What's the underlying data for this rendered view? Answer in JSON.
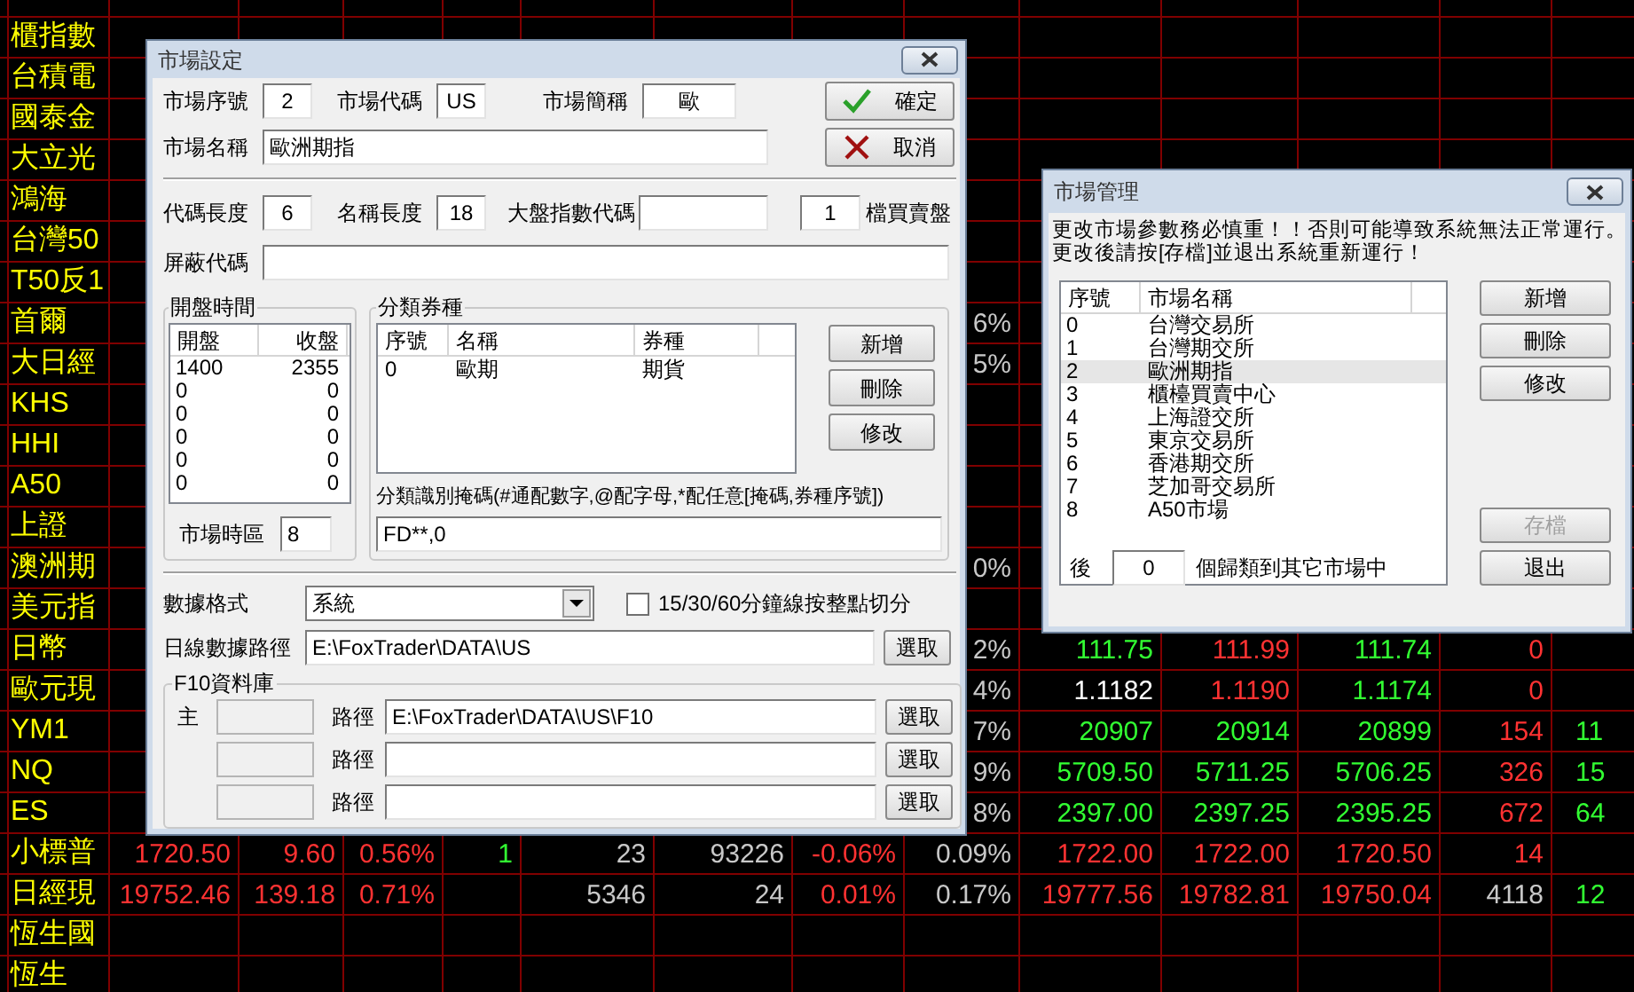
{
  "quote_table": {
    "rows": [
      {},
      {
        "name": "櫃指數"
      },
      {
        "name": "台積電"
      },
      {
        "name": "國泰金"
      },
      {
        "name": "大立光"
      },
      {
        "name": "鴻海"
      },
      {
        "name": "台灣50"
      },
      {
        "name": "T50反1"
      },
      {
        "name": "首爾",
        "cells": [
          null,
          null,
          null,
          null,
          null,
          null,
          null,
          {
            "text": "6%",
            "color": "#c8c8c8"
          }
        ]
      },
      {
        "name": "大日經",
        "cells": [
          null,
          null,
          null,
          null,
          null,
          null,
          null,
          {
            "text": "5%",
            "color": "#c8c8c8"
          }
        ]
      },
      {
        "name": "KHS"
      },
      {
        "name": "HHI"
      },
      {
        "name": "A50"
      },
      {
        "name": "上證"
      },
      {
        "name": "澳洲期",
        "cells": [
          null,
          null,
          null,
          null,
          null,
          null,
          null,
          {
            "text": "0%",
            "color": "#c8c8c8"
          }
        ]
      },
      {
        "name": "美元指"
      },
      {
        "name": "日幣",
        "cells": [
          null,
          null,
          null,
          null,
          null,
          null,
          null,
          {
            "text": "2%",
            "color": "#c8c8c8"
          },
          {
            "text": "111.75",
            "color": "#32ff32"
          },
          {
            "text": "111.99",
            "color": "#ff3232"
          },
          {
            "text": "111.74",
            "color": "#32ff32"
          },
          {
            "text": "0",
            "color": "#ff3232"
          }
        ]
      },
      {
        "name": "歐元現",
        "cells": [
          null,
          null,
          null,
          null,
          null,
          null,
          null,
          {
            "text": "4%",
            "color": "#c8c8c8"
          },
          {
            "text": "1.1182",
            "color": "#ffffff"
          },
          {
            "text": "1.1190",
            "color": "#ff3232"
          },
          {
            "text": "1.1174",
            "color": "#32ff32"
          },
          {
            "text": "0",
            "color": "#ff3232"
          }
        ]
      },
      {
        "name": "YM1",
        "cells": [
          null,
          null,
          null,
          null,
          null,
          null,
          null,
          {
            "text": "7%",
            "color": "#c8c8c8"
          },
          {
            "text": "20907",
            "color": "#32ff32"
          },
          {
            "text": "20914",
            "color": "#32ff32"
          },
          {
            "text": "20899",
            "color": "#32ff32"
          },
          {
            "text": "154",
            "color": "#ff3232"
          },
          {
            "text": "11",
            "color": "#32ff32",
            "cut": true
          }
        ]
      },
      {
        "name": "NQ",
        "cells": [
          null,
          null,
          null,
          null,
          null,
          null,
          null,
          {
            "text": "9%",
            "color": "#c8c8c8"
          },
          {
            "text": "5709.50",
            "color": "#32ff32"
          },
          {
            "text": "5711.25",
            "color": "#32ff32"
          },
          {
            "text": "5706.25",
            "color": "#32ff32"
          },
          {
            "text": "326",
            "color": "#ff3232"
          },
          {
            "text": "15",
            "color": "#32ff32",
            "cut": true
          }
        ]
      },
      {
        "name": "ES",
        "cells": [
          null,
          null,
          null,
          null,
          null,
          null,
          null,
          {
            "text": "8%",
            "color": "#c8c8c8"
          },
          {
            "text": "2397.00",
            "color": "#32ff32"
          },
          {
            "text": "2397.25",
            "color": "#32ff32"
          },
          {
            "text": "2395.25",
            "color": "#32ff32"
          },
          {
            "text": "672",
            "color": "#ff3232"
          },
          {
            "text": "64",
            "color": "#32ff32",
            "cut": true
          }
        ]
      },
      {
        "name": "小標普",
        "cells": [
          {
            "text": "1720.50",
            "color": "#ff3232"
          },
          {
            "text": "9.60",
            "color": "#ff3232"
          },
          {
            "text": "0.56%",
            "color": "#ff3232"
          },
          {
            "text": "1",
            "color": "#32ff32"
          },
          {
            "text": "23",
            "color": "#c8c8c8"
          },
          {
            "text": "93226",
            "color": "#c8c8c8"
          },
          {
            "text": "-0.06%",
            "color": "#ff3232"
          },
          {
            "text": "0.09%",
            "color": "#c8c8c8"
          },
          {
            "text": "1722.00",
            "color": "#ff3232"
          },
          {
            "text": "1722.00",
            "color": "#ff3232"
          },
          {
            "text": "1720.50",
            "color": "#ff3232"
          },
          {
            "text": "14",
            "color": "#ff3232"
          }
        ]
      },
      {
        "name": "日經現",
        "cells": [
          {
            "text": "19752.46",
            "color": "#ff3232"
          },
          {
            "text": "139.18",
            "color": "#ff3232"
          },
          {
            "text": "0.71%",
            "color": "#ff3232"
          },
          null,
          {
            "text": "5346",
            "color": "#c8c8c8"
          },
          {
            "text": "24",
            "color": "#c8c8c8"
          },
          {
            "text": "0.01%",
            "color": "#ff3232"
          },
          {
            "text": "0.17%",
            "color": "#c8c8c8"
          },
          {
            "text": "19777.56",
            "color": "#ff3232"
          },
          {
            "text": "19782.81",
            "color": "#ff3232"
          },
          {
            "text": "19750.04",
            "color": "#ff3232"
          },
          {
            "text": "4118",
            "color": "#c8c8c8"
          },
          {
            "text": "12",
            "color": "#32ff32",
            "cut": true
          }
        ]
      },
      {
        "name": "恆生國"
      },
      {
        "name": "恆生"
      }
    ]
  },
  "market_settings_dialog": {
    "title": "市場設定",
    "row1": [
      {
        "label": "市場序號",
        "value": "2"
      },
      {
        "label": "市場代碼",
        "value": "US"
      },
      {
        "label": "市場簡稱",
        "value": "歐"
      }
    ],
    "market_name": {
      "label": "市場名稱",
      "value": "歐洲期指"
    },
    "ok_button": "確定",
    "cancel_button": "取消",
    "row3": [
      {
        "label": "代碼長度",
        "value": "6"
      },
      {
        "label": "名稱長度",
        "value": "18"
      },
      {
        "label": "大盤指數代碼"
      }
    ],
    "depth": {
      "value": "1",
      "label": "檔買賣盤"
    },
    "mask_code": {
      "label": "屏蔽代碼"
    },
    "trading_hours": {
      "title": "開盤時間",
      "columns": [
        "開盤",
        "收盤"
      ],
      "rows": [
        [
          "1400",
          "2355"
        ],
        [
          "0",
          "0"
        ],
        [
          "0",
          "0"
        ],
        [
          "0",
          "0"
        ],
        [
          "0",
          "0"
        ],
        [
          "0",
          "0"
        ]
      ],
      "timezone": {
        "label": "市場時區",
        "value": "8"
      }
    },
    "categories": {
      "title": "分類券種",
      "columns": [
        "序號",
        "名稱",
        "券種"
      ],
      "rows": [
        [
          "0",
          "歐期",
          "期貨"
        ]
      ],
      "buttons": [
        "新增",
        "刪除",
        "修改"
      ],
      "mask_label": "分類識別掩碼(#通配數字,@配字母,*配任意[掩碼,券種序號])",
      "mask_value": "FD**,0"
    },
    "data_format": {
      "label": "數據格式",
      "value": "系統"
    },
    "split_checkbox": {
      "label": "15/30/60分鐘線按整點切分",
      "checked": false
    },
    "daily_path": {
      "label": "日線數據路徑",
      "value": "E:\\FoxTrader\\DATA\\US",
      "button": "選取"
    },
    "f10": {
      "title": "F10資料庫",
      "rows": [
        {
          "label": "主",
          "path_label": "路徑",
          "value": "E:\\FoxTrader\\DATA\\US\\F10",
          "button": "選取"
        },
        {
          "path_label": "路徑",
          "button": "選取"
        },
        {
          "path_label": "路徑",
          "button": "選取"
        }
      ]
    }
  },
  "market_manager_dialog": {
    "title": "市場管理",
    "warning_lines": [
      "更改市場參數務必慎重！！否則可能導致系統無法正常運行。",
      "更改後請按[存檔]並退出系統重新運行！"
    ],
    "columns": [
      "序號",
      "市場名稱"
    ],
    "markets": [
      {
        "index": "0",
        "name": "台灣交易所",
        "selected": false
      },
      {
        "index": "1",
        "name": "台灣期交所",
        "selected": false
      },
      {
        "index": "2",
        "name": "歐洲期指",
        "selected": true
      },
      {
        "index": "3",
        "name": "櫃檯買賣中心",
        "selected": false
      },
      {
        "index": "4",
        "name": "上海證交所",
        "selected": false
      },
      {
        "index": "5",
        "name": "東京交易所",
        "selected": false
      },
      {
        "index": "6",
        "name": "香港期交所",
        "selected": false
      },
      {
        "index": "7",
        "name": "芝加哥交易所",
        "selected": false
      },
      {
        "index": "8",
        "name": "A50市場",
        "selected": false
      }
    ],
    "buttons": [
      {
        "label": "新增",
        "disabled": false
      },
      {
        "label": "刪除",
        "disabled": false
      },
      {
        "label": "修改",
        "disabled": false
      }
    ],
    "bottom_buttons": [
      {
        "label": "存檔",
        "disabled": true
      },
      {
        "label": "退出",
        "disabled": false
      }
    ],
    "footer": {
      "before": "後",
      "value": "0",
      "after": "個歸類到其它市場中"
    }
  }
}
